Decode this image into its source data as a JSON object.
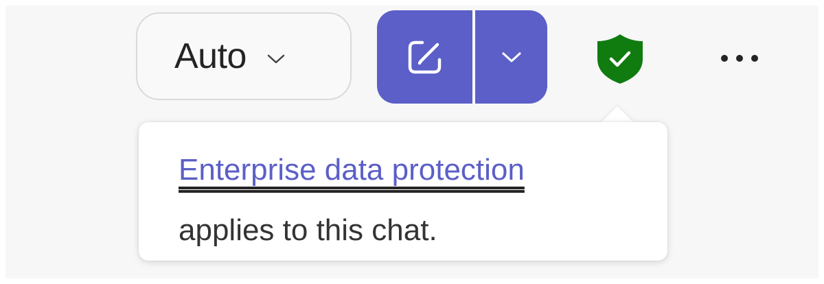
{
  "toolbar": {
    "mode_select": {
      "value": "Auto",
      "icon": "chevron-down-icon"
    },
    "compose_button": {
      "icon": "compose-icon"
    },
    "compose_dropdown": {
      "icon": "chevron-down-icon"
    },
    "protection_badge": {
      "icon": "shield-check-icon"
    },
    "more_button": {
      "icon": "more-horizontal-icon"
    }
  },
  "popover": {
    "link_text": "Enterprise data protection",
    "message": "applies to this chat."
  },
  "colors": {
    "accent": "#5b5fc7",
    "shield": "#107c10",
    "text": "#242424",
    "panel_background": "#f7f7f7"
  }
}
